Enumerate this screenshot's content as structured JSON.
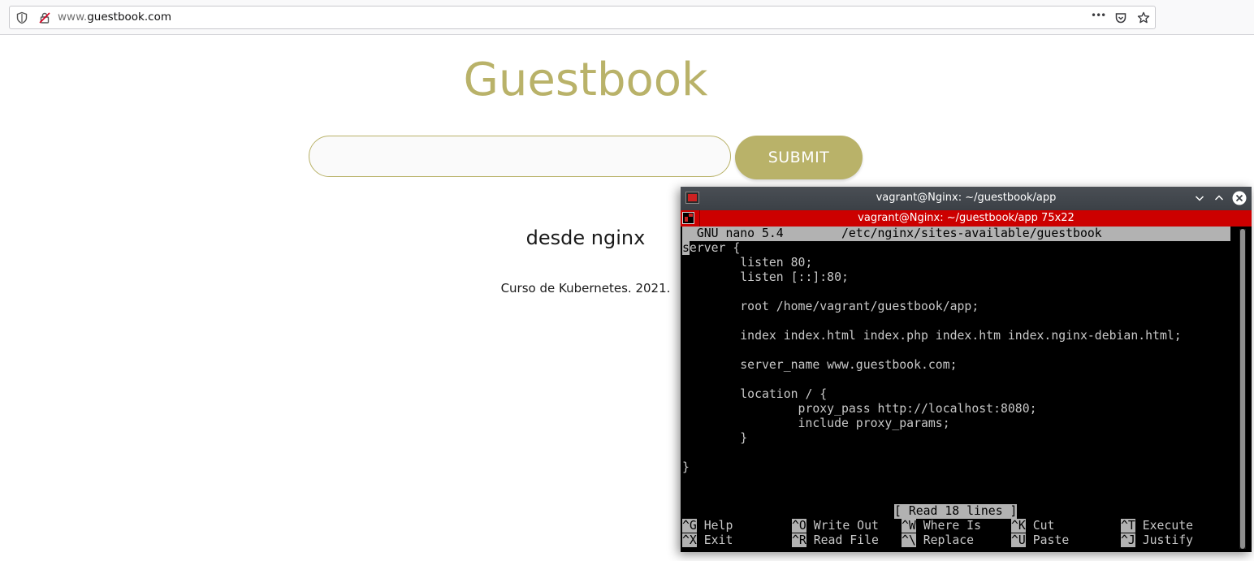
{
  "browser": {
    "url_prefix": "www.",
    "url_host": "guestbook.com",
    "menu_dots": "•••"
  },
  "guestbook": {
    "title": "Guestbook",
    "input_value": "",
    "submit_label": "SUBMIT",
    "entries": [
      "desde nginx"
    ],
    "footer": "Curso de Kubernetes. 2021."
  },
  "terminal": {
    "window_title": "vagrant@Nginx: ~/guestbook/app",
    "tab_title": "vagrant@Nginx: ~/guestbook/app 75x22",
    "nano_header": "  GNU nano 5.4        /etc/nginx/sites-available/guestbook",
    "cursor_char": "s",
    "lines": [
      "erver {",
      "        listen 80;",
      "        listen [::]:80;",
      "",
      "        root /home/vagrant/guestbook/app;",
      "",
      "        index index.html index.php index.htm index.nginx-debian.html;",
      "",
      "        server_name www.guestbook.com;",
      "",
      "        location / {",
      "                proxy_pass http://localhost:8080;",
      "                include proxy_params;",
      "        }",
      "",
      "}"
    ],
    "status_message": "[ Read 18 lines ]",
    "shortcuts_row1": [
      {
        "key": "^G",
        "label": " Help"
      },
      {
        "key": "^O",
        "label": " Write Out"
      },
      {
        "key": "^W",
        "label": " Where Is"
      },
      {
        "key": "^K",
        "label": " Cut"
      },
      {
        "key": "^T",
        "label": " Execute"
      }
    ],
    "shortcuts_row2": [
      {
        "key": "^X",
        "label": " Exit"
      },
      {
        "key": "^R",
        "label": " Read File"
      },
      {
        "key": "^\\",
        "label": " Replace"
      },
      {
        "key": "^U",
        "label": " Paste"
      },
      {
        "key": "^J",
        "label": " Justify"
      }
    ]
  },
  "colors": {
    "accent": "#b9b269",
    "terminal_tab": "#cc0000",
    "terminal_bg": "#000000"
  }
}
